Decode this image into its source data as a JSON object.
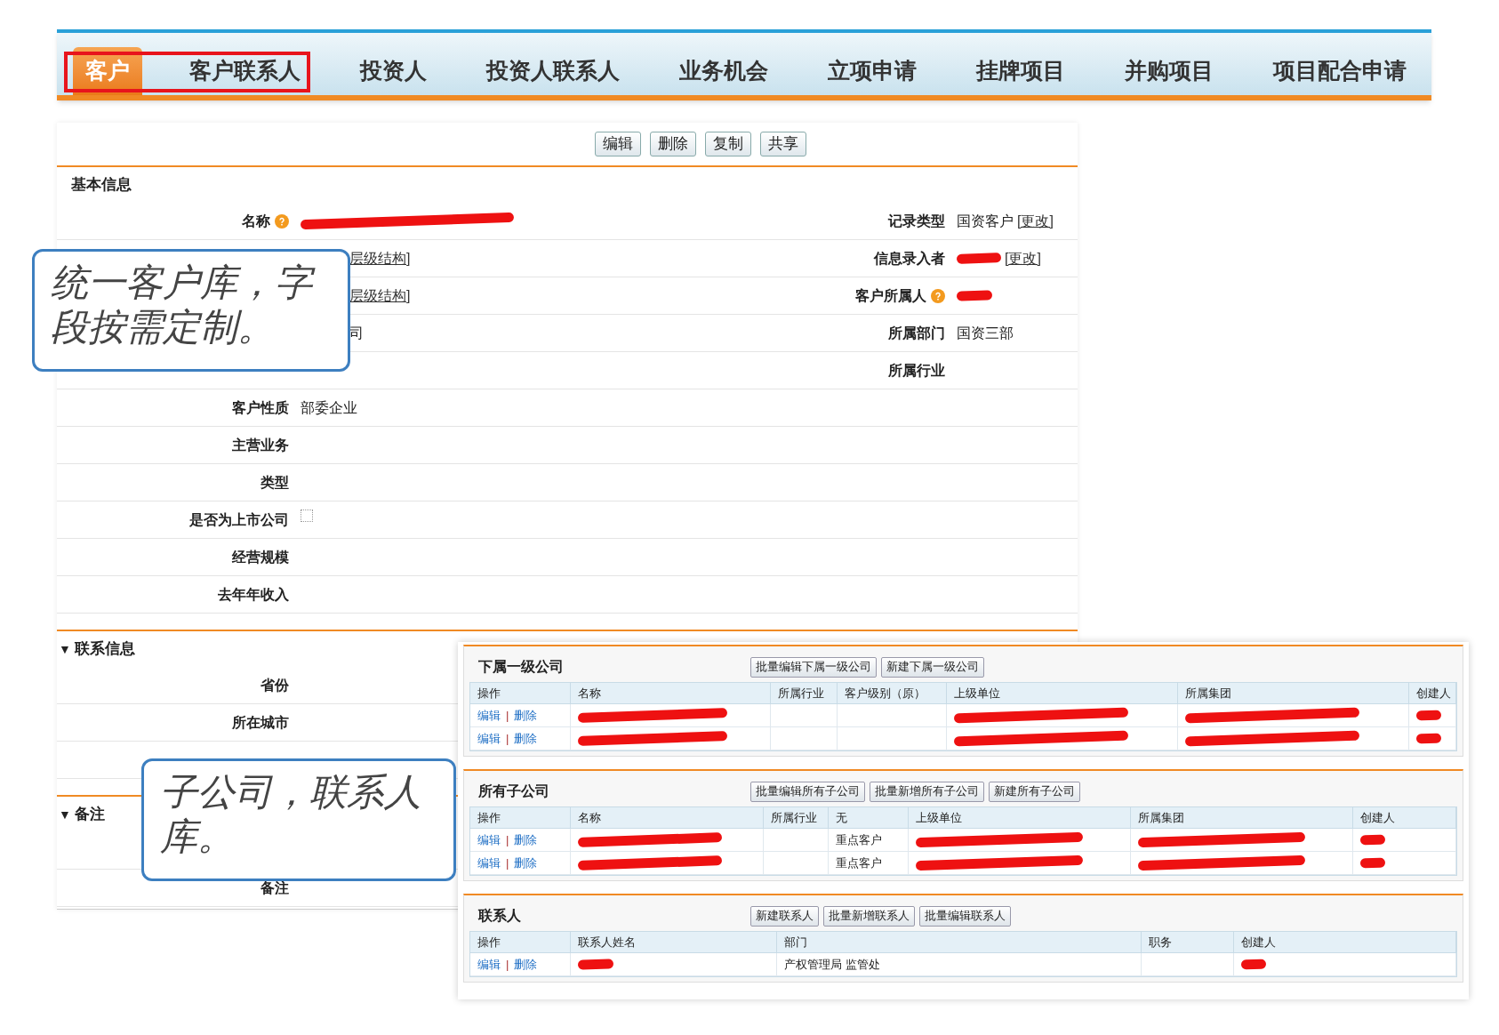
{
  "nav": {
    "tabs": [
      {
        "label": "客户",
        "selected": true
      },
      {
        "label": "客户联系人",
        "selected": false
      },
      {
        "label": "投资人",
        "selected": false
      },
      {
        "label": "投资人联系人",
        "selected": false
      },
      {
        "label": "业务机会",
        "selected": false
      },
      {
        "label": "立项申请",
        "selected": false
      },
      {
        "label": "挂牌项目",
        "selected": false
      },
      {
        "label": "并购项目",
        "selected": false
      },
      {
        "label": "项目配合申请",
        "selected": false
      }
    ]
  },
  "toolbar": {
    "buttons": [
      "编辑",
      "删除",
      "复制",
      "共享"
    ]
  },
  "sections": [
    {
      "title": "基本信息",
      "rows": [
        {
          "left": {
            "label": "名称",
            "help": true,
            "value": [
              {
                "kind": "redacted"
              }
            ]
          },
          "right": {
            "label": "记录类型",
            "value": [
              {
                "kind": "text",
                "text": "国资客户"
              },
              {
                "kind": "link",
                "text": "[更改]"
              }
            ]
          }
        },
        {
          "left": {
            "value": [
              {
                "kind": "cutlink",
                "text": "层级结构]"
              }
            ]
          },
          "right": {
            "label": "信息录入者",
            "value": [
              {
                "kind": "redacted"
              },
              {
                "kind": "link",
                "text": "[更改]"
              }
            ]
          }
        },
        {
          "left": {
            "value": [
              {
                "kind": "cutlink",
                "text": "层级结构]"
              }
            ]
          },
          "right": {
            "label": "客户所属人",
            "help": true,
            "value": [
              {
                "kind": "redacted"
              }
            ]
          }
        },
        {
          "left": {
            "value": [
              {
                "kind": "cuttext",
                "text": "司"
              }
            ]
          },
          "right": {
            "label": "所属部门",
            "value": [
              {
                "kind": "text",
                "text": "国资三部"
              }
            ]
          }
        },
        {
          "right": {
            "label": "所属行业"
          }
        },
        {
          "left": {
            "label": "客户性质",
            "value": [
              {
                "kind": "text",
                "text": "部委企业"
              }
            ]
          }
        },
        {
          "left": {
            "label": "主营业务"
          }
        },
        {
          "left": {
            "label": "类型"
          }
        },
        {
          "left": {
            "label": "是否为上市公司",
            "value": [
              {
                "kind": "checkbox",
                "checked": false
              }
            ]
          }
        },
        {
          "left": {
            "label": "经营规模"
          }
        },
        {
          "left": {
            "label": "去年年收入"
          }
        }
      ]
    },
    {
      "title": "联系信息",
      "toggle": "▼",
      "rows": [
        {
          "left": {
            "label": "省份"
          }
        },
        {
          "left": {
            "label": "所在城市"
          }
        },
        {}
      ]
    },
    {
      "title": "备注",
      "toggle": "▼",
      "rows": [
        {},
        {
          "left": {
            "label": "备注"
          }
        }
      ]
    }
  ],
  "related": [
    {
      "title": "下属一级公司",
      "buttons": [
        "批量编辑下属一级公司",
        "新建下属一级公司"
      ],
      "columns": [
        "操作",
        "名称",
        "所属行业",
        "客户级别（原）",
        "上级单位",
        "所属集团",
        "创建人"
      ],
      "rows": [
        [
          {
            "kind": "actions",
            "edit": "编辑",
            "sep": "|",
            "delete": "删除"
          },
          {
            "kind": "redacted"
          },
          {
            "kind": "empty"
          },
          {
            "kind": "empty"
          },
          {
            "kind": "redacted"
          },
          {
            "kind": "redacted"
          },
          {
            "kind": "redacted"
          }
        ],
        [
          {
            "kind": "actions",
            "edit": "编辑",
            "sep": "|",
            "delete": "删除"
          },
          {
            "kind": "redacted"
          },
          {
            "kind": "empty"
          },
          {
            "kind": "empty"
          },
          {
            "kind": "redacted"
          },
          {
            "kind": "redacted"
          },
          {
            "kind": "redacted"
          }
        ]
      ]
    },
    {
      "title": "所有子公司",
      "buttons": [
        "批量编辑所有子公司",
        "批量新增所有子公司",
        "新建所有子公司"
      ],
      "columns": [
        "操作",
        "名称",
        "所属行业",
        "无",
        "上级单位",
        "所属集团",
        "创建人"
      ],
      "rows": [
        [
          {
            "kind": "actions",
            "edit": "编辑",
            "sep": "|",
            "delete": "删除"
          },
          {
            "kind": "redacted"
          },
          {
            "kind": "empty"
          },
          {
            "kind": "text",
            "text": "重点客户"
          },
          {
            "kind": "redacted"
          },
          {
            "kind": "redacted"
          },
          {
            "kind": "redacted"
          }
        ],
        [
          {
            "kind": "actions",
            "edit": "编辑",
            "sep": "|",
            "delete": "删除"
          },
          {
            "kind": "redacted"
          },
          {
            "kind": "empty"
          },
          {
            "kind": "text",
            "text": "重点客户"
          },
          {
            "kind": "redacted"
          },
          {
            "kind": "redacted"
          },
          {
            "kind": "redacted"
          }
        ]
      ]
    },
    {
      "title": "联系人",
      "buttons": [
        "新建联系人",
        "批量新增联系人",
        "批量编辑联系人"
      ],
      "columns": [
        "操作",
        "联系人姓名",
        "部门",
        "职务",
        "创建人"
      ],
      "rows": [
        [
          {
            "kind": "actions",
            "edit": "编辑",
            "sep": "|",
            "delete": "删除"
          },
          {
            "kind": "redacted"
          },
          {
            "kind": "text",
            "text": "产权管理局 监管处"
          },
          {
            "kind": "empty"
          },
          {
            "kind": "redacted"
          }
        ]
      ]
    }
  ],
  "callouts": [
    {
      "text": "统一客户库，字段按需定制。"
    },
    {
      "text": "子公司，联系人库。"
    }
  ]
}
